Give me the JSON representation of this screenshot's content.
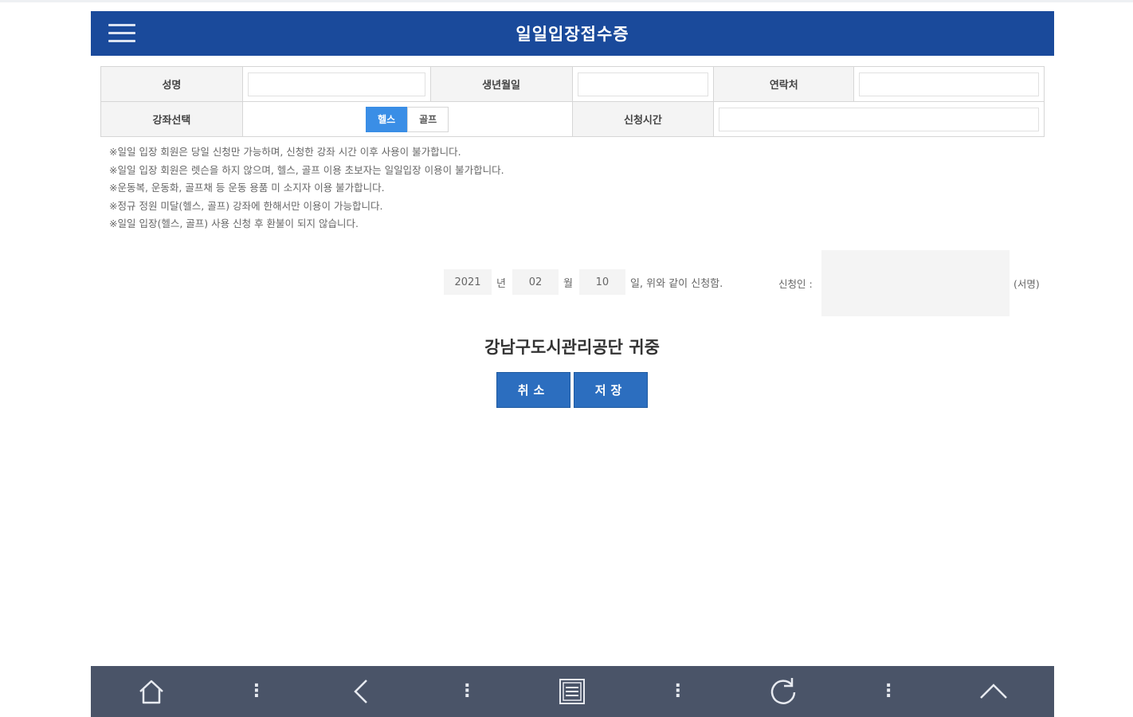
{
  "header": {
    "title": "일일입장접수증",
    "menu_icon": "hamburger-menu-icon"
  },
  "form": {
    "name_label": "성명",
    "name_value": "",
    "birth_label": "생년월일",
    "birth_value": "",
    "contact_label": "연락처",
    "contact_value": "",
    "course_label": "강좌선택",
    "course_options": [
      "헬스",
      "골프"
    ],
    "course_selected": "헬스",
    "time_label": "신청시간",
    "time_value": ""
  },
  "notices": [
    "※일일 입장 회원은 당일 신청만 가능하며, 신청한 강좌 시간 이후 사용이 불가합니다.",
    "※일일 입장 회원은 렛슨을 하지 않으며, 헬스, 골프 이용 초보자는 일일입장 이용이 불가합니다.",
    "※운동복, 운동화, 골프채 등 운동 용품 미 소지자 이용 불가합니다.",
    "※정규 정원 미달(헬스, 골프) 강좌에 한해서만 이용이 가능합니다.",
    "※일일 입장(헬스, 골프) 사용 신청 후 환불이 되지 않습니다."
  ],
  "date": {
    "year": "2021",
    "year_unit": "년",
    "month": "02",
    "month_unit": "월",
    "day": "10",
    "day_suffix": "일, 위와 같이 신청함."
  },
  "applicant": {
    "label": "신청인 :",
    "suffix": "(서명)"
  },
  "organization": "강남구도시관리공단 귀중",
  "buttons": {
    "cancel": "취소",
    "save": "저장"
  },
  "bottom_nav": {
    "icons": [
      "home-icon",
      "back-icon",
      "list-icon",
      "refresh-icon",
      "scroll-top-icon"
    ],
    "separator": "⋮"
  },
  "colors": {
    "header_bg": "#1a4a9b",
    "accent": "#3a8ee6",
    "button_bg": "#2c6ebf",
    "bottom_bar_bg": "#4a5468"
  }
}
